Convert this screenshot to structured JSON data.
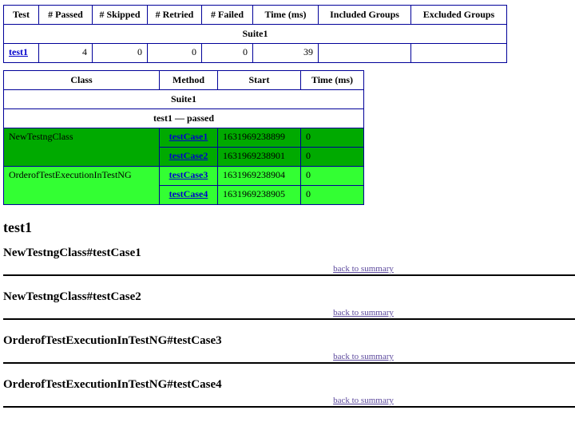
{
  "colors": {
    "table_border": "#000099",
    "passed_dark_row_bg": "#00AA00",
    "passed_light_row_bg": "#33FF33",
    "link_blue": "#0000CC",
    "visited_link_purple": "#5E4B9E",
    "separator_rule": "#000000"
  },
  "summary_table": {
    "headers": [
      "Test",
      "# Passed",
      "# Skipped",
      "# Retried",
      "# Failed",
      "Time (ms)",
      "Included Groups",
      "Excluded Groups"
    ],
    "suite_label": "Suite1",
    "row": {
      "test": "test1",
      "passed": "4",
      "skipped": "0",
      "retried": "0",
      "failed": "0",
      "time_ms": "39",
      "included_groups": "",
      "excluded_groups": ""
    }
  },
  "methods_table": {
    "headers": [
      "Class",
      "Method",
      "Start",
      "Time (ms)"
    ],
    "suite_label": "Suite1",
    "test_label": "test1 — passed",
    "groups": [
      {
        "class_name": "NewTestngClass",
        "methods": [
          {
            "name": "testCase1",
            "start": "1631969238899",
            "time_ms": "0"
          },
          {
            "name": "testCase2",
            "start": "1631969238901",
            "time_ms": "0"
          }
        ]
      },
      {
        "class_name": "OrderofTestExecutionInTestNG",
        "methods": [
          {
            "name": "testCase3",
            "start": "1631969238904",
            "time_ms": "0"
          },
          {
            "name": "testCase4",
            "start": "1631969238905",
            "time_ms": "0"
          }
        ]
      }
    ]
  },
  "details": {
    "test_title": "test1",
    "back_link_label": "back to summary",
    "sections": [
      {
        "heading": "NewTestngClass#testCase1"
      },
      {
        "heading": "NewTestngClass#testCase2"
      },
      {
        "heading": "OrderofTestExecutionInTestNG#testCase3"
      },
      {
        "heading": "OrderofTestExecutionInTestNG#testCase4"
      }
    ]
  }
}
